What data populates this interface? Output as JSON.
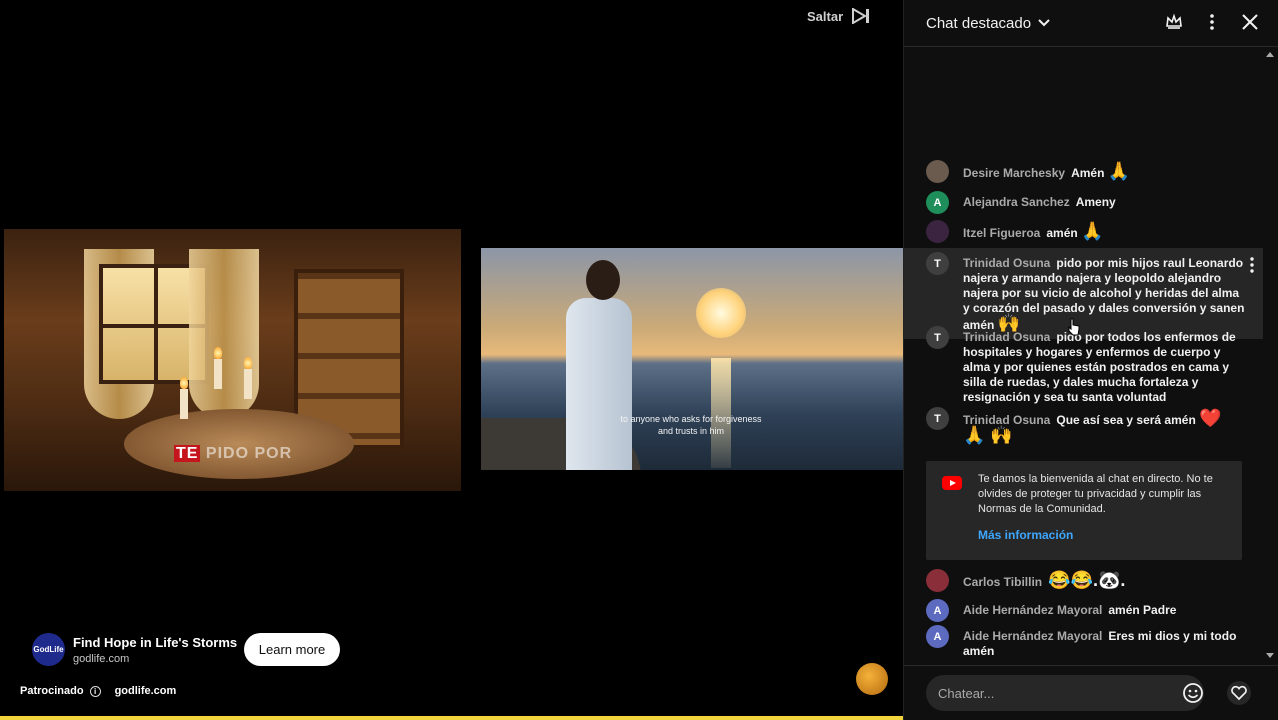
{
  "video": {
    "skip_label": "Saltar",
    "ad_left_caption_hl": "TE",
    "ad_left_caption_rest": " PIDO POR",
    "ad_right_subtitle_line1": "to anyone who asks for forgiveness",
    "ad_right_subtitle_line2": "and trusts in him",
    "sponsor_title": "Find Hope in Life's Storms",
    "sponsor_domain": "godlife.com",
    "sponsor_logo_text": "GodLife",
    "learn_more_label": "Learn more",
    "sponsored_label": "Patrocinado",
    "sponsored_domain": "godlife.com",
    "progress_percent": 100,
    "colors": {
      "progress": "#f2d53c"
    }
  },
  "chat": {
    "title": "Chat destacado",
    "messages": [
      {
        "author": "Desire Marchesky",
        "text": "Amén",
        "emoji": "🙏",
        "avatar_letter": "",
        "avatar_color": "#6b5a4e"
      },
      {
        "author": "Alejandra Sanchez",
        "text": "Ameny",
        "emoji": "",
        "avatar_letter": "A",
        "avatar_color": "#1e8e5a"
      },
      {
        "author": "Itzel Figueroa",
        "text": "amén",
        "emoji": "🙏",
        "avatar_letter": "",
        "avatar_color": "#3a2440"
      },
      {
        "author": "Trinidad Osuna",
        "text": "pido por mis hijos raul Leonardo najera y armando najera y leopoldo alejandro najera por su vicio de alcohol y heridas del alma y corazón del pasado y dales conversión y sanen amén",
        "emoji": "🙌",
        "avatar_letter": "T",
        "avatar_color": "#3f3f3f"
      },
      {
        "author": "Trinidad Osuna",
        "text": "pido por todos los enfermos de hospitales y hogares y enfermos de cuerpo y alma y por quienes están postrados en cama y silla de ruedas, y dales mucha fortaleza y resignación y sea tu santa voluntad",
        "emoji": "",
        "avatar_letter": "T",
        "avatar_color": "#3f3f3f"
      },
      {
        "author": "Trinidad Osuna",
        "text": "Que así sea y será amén",
        "emoji": "❤️",
        "emoji2": "🙏 🙌",
        "avatar_letter": "T",
        "avatar_color": "#3f3f3f"
      },
      {
        "author": "Carlos Tibillin",
        "text": "",
        "emoji": "😂😂.🐼.",
        "avatar_letter": "",
        "avatar_color": "#8a2f3a"
      },
      {
        "author": "Aide Hernández Mayoral",
        "text": "amén Padre",
        "emoji": "",
        "avatar_letter": "A",
        "avatar_color": "#5c6bc0"
      },
      {
        "author": "Aide Hernández Mayoral",
        "text": "Eres mi dios y mi todo amén",
        "emoji": "",
        "avatar_letter": "A",
        "avatar_color": "#5c6bc0"
      }
    ],
    "welcome": {
      "text": "Te damos la bienvenida al chat en directo. No te olvides de proteger tu privacidad y cumplir las Normas de la Comunidad.",
      "link": "Más información"
    },
    "composer_placeholder": "Chatear..."
  }
}
